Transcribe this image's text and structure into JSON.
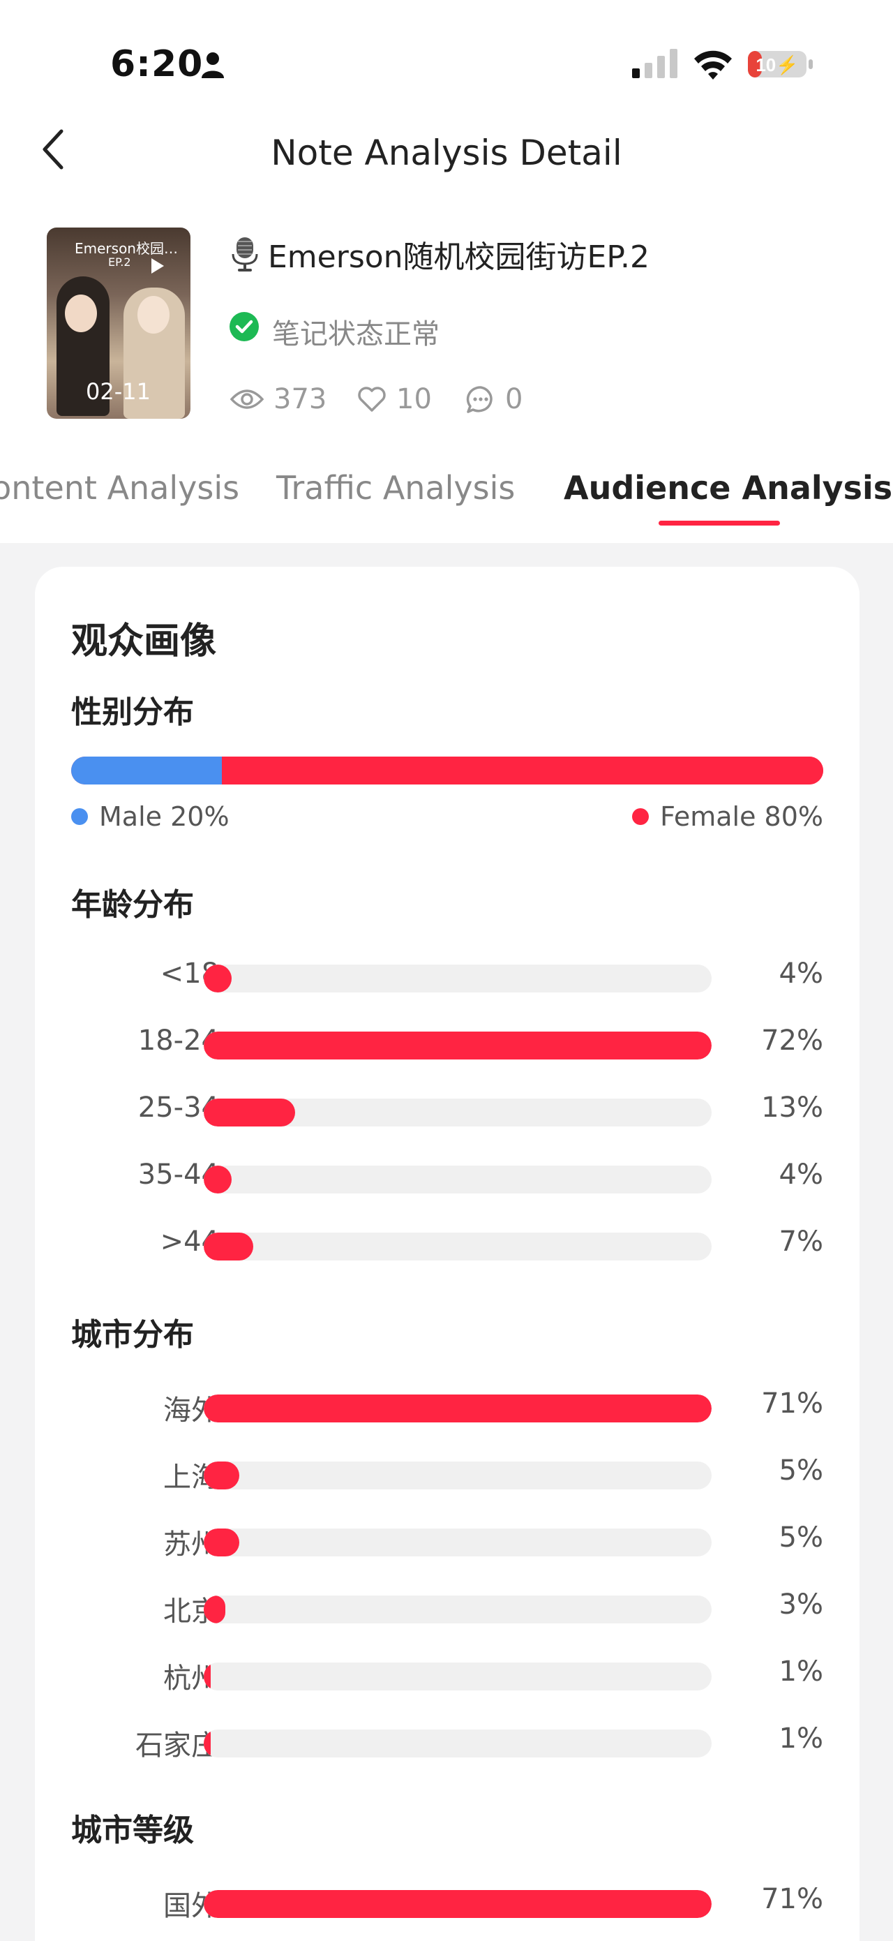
{
  "status_bar": {
    "time": "6:20",
    "battery": "10"
  },
  "nav": {
    "title": "Note Analysis Detail"
  },
  "note": {
    "title": "Emerson随机校园街访EP.2",
    "status": "笔记状态正常",
    "thumbnail": {
      "overlay_title": "Emerson校园…",
      "overlay_sub": "EP.2",
      "date": "02-11"
    },
    "stats": {
      "views": "373",
      "likes": "10",
      "comments": "0"
    }
  },
  "tabs": [
    {
      "label": "Content Analysis",
      "active": false
    },
    {
      "label": "Traffic Analysis",
      "active": false
    },
    {
      "label": "Audience Analysis",
      "active": true
    }
  ],
  "card": {
    "title": "观众画像",
    "gender": {
      "title": "性别分布",
      "male": {
        "label": "Male 20%",
        "value": 20,
        "color": "#4a90f0"
      },
      "female": {
        "label": "Female 80%",
        "value": 80,
        "color": "#ff2442"
      }
    },
    "age": {
      "title": "年龄分布",
      "rows": [
        {
          "label": "<18",
          "value": 4,
          "text": "4%"
        },
        {
          "label": "18-24",
          "value": 72,
          "text": "72%"
        },
        {
          "label": "25-34",
          "value": 13,
          "text": "13%"
        },
        {
          "label": "35-44",
          "value": 4,
          "text": "4%"
        },
        {
          "label": ">44",
          "value": 7,
          "text": "7%"
        }
      ]
    },
    "city": {
      "title": "城市分布",
      "rows": [
        {
          "label": "海外",
          "value": 71,
          "text": "71%"
        },
        {
          "label": "上海",
          "value": 5,
          "text": "5%"
        },
        {
          "label": "苏州",
          "value": 5,
          "text": "5%"
        },
        {
          "label": "北京",
          "value": 3,
          "text": "3%"
        },
        {
          "label": "杭州",
          "value": 1,
          "text": "1%"
        },
        {
          "label": "石家庄",
          "value": 1,
          "text": "1%"
        }
      ]
    },
    "city_tier": {
      "title": "城市等级",
      "rows": [
        {
          "label": "国外",
          "value": 71,
          "text": "71%"
        }
      ]
    }
  },
  "colors": {
    "accent": "#ff2442",
    "male": "#4a90f0",
    "track": "#f0f0f0"
  }
}
